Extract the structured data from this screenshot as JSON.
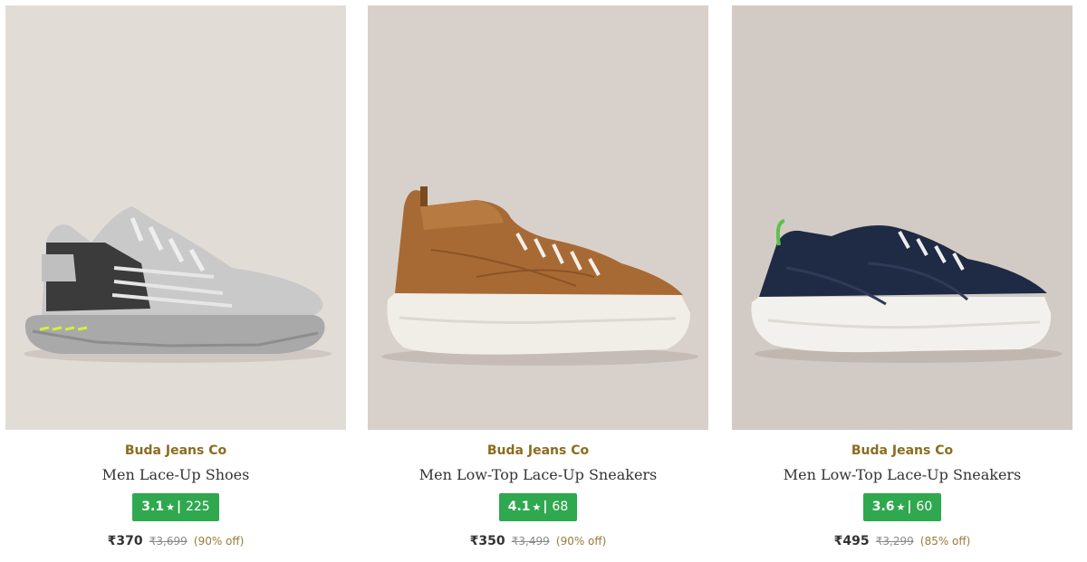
{
  "colors": {
    "brand_text": "#8a6d1f",
    "rating_badge": "#2fa84f",
    "discount_text": "#9a7a3a"
  },
  "products": [
    {
      "image_icon": "grey-sneaker-image",
      "brand": "Buda Jeans Co",
      "title": "Men Lace-Up Shoes",
      "rating": "3.1",
      "star": "★",
      "reviews": "225",
      "price": "₹370",
      "mrp": "₹3,699",
      "discount": "(90% off)"
    },
    {
      "image_icon": "tan-high-top-sneaker-image",
      "brand": "Buda Jeans Co",
      "title": "Men Low-Top Lace-Up Sneakers",
      "rating": "4.1",
      "star": "★",
      "reviews": "68",
      "price": "₹350",
      "mrp": "₹3,499",
      "discount": "(90% off)"
    },
    {
      "image_icon": "navy-sneaker-image",
      "brand": "Buda Jeans Co",
      "title": "Men Low-Top Lace-Up Sneakers",
      "rating": "3.6",
      "star": "★",
      "reviews": "60",
      "price": "₹495",
      "mrp": "₹3,299",
      "discount": "(85% off)"
    }
  ]
}
